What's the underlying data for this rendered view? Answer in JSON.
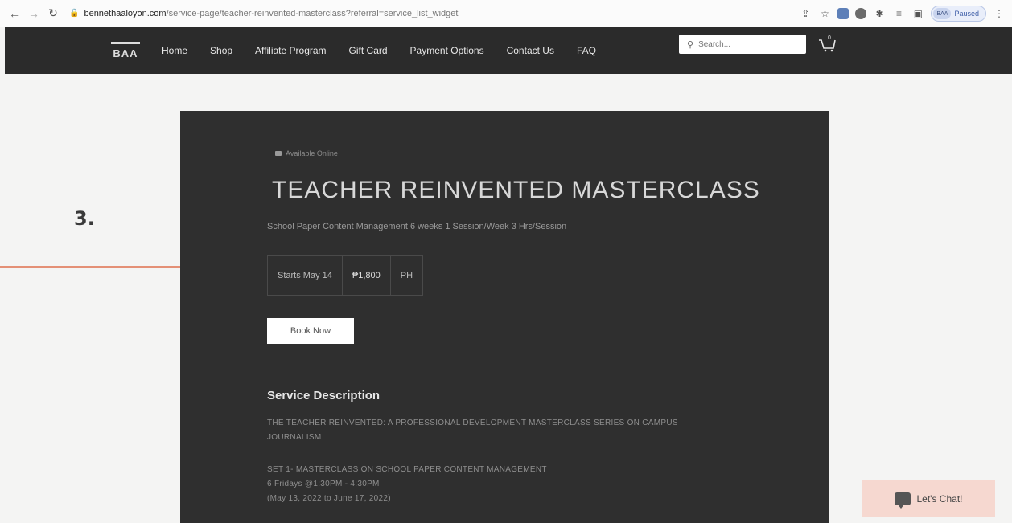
{
  "browser": {
    "url_host": "bennethaaloyon.com",
    "url_path": "/service-page/teacher-reinvented-masterclass?referral=service_list_widget",
    "profile_label": "BAA",
    "profile_status": "Paused"
  },
  "site": {
    "logo": "BAA",
    "nav": [
      "Home",
      "Shop",
      "Affiliate Program",
      "Gift Card",
      "Payment Options",
      "Contact Us",
      "FAQ"
    ],
    "search_placeholder": "Search...",
    "cart_count": "0"
  },
  "service": {
    "availability": "Available Online",
    "title": "TEACHER REINVENTED MASTERCLASS",
    "subtitle": "School Paper Content Management 6 weeks 1 Session/Week 3 Hrs/Session",
    "start": "Starts May 14",
    "price": "₱1,800",
    "location": "PH",
    "book_label": "Book Now",
    "description_heading": "Service Description",
    "description_lines": [
      "THE TEACHER REINVENTED: A PROFESSIONAL DEVELOPMENT MASTERCLASS SERIES ON CAMPUS",
      "JOURNALISM",
      "SET 1- MASTERCLASS ON SCHOOL PAPER CONTENT MANAGEMENT",
      "6 Fridays @1:30PM - 4:30PM",
      "(May 13, 2022 to June 17, 2022)"
    ]
  },
  "annotation": {
    "step": "3.",
    "color": "#d9552b"
  },
  "chat": {
    "label": "Let's Chat!"
  }
}
